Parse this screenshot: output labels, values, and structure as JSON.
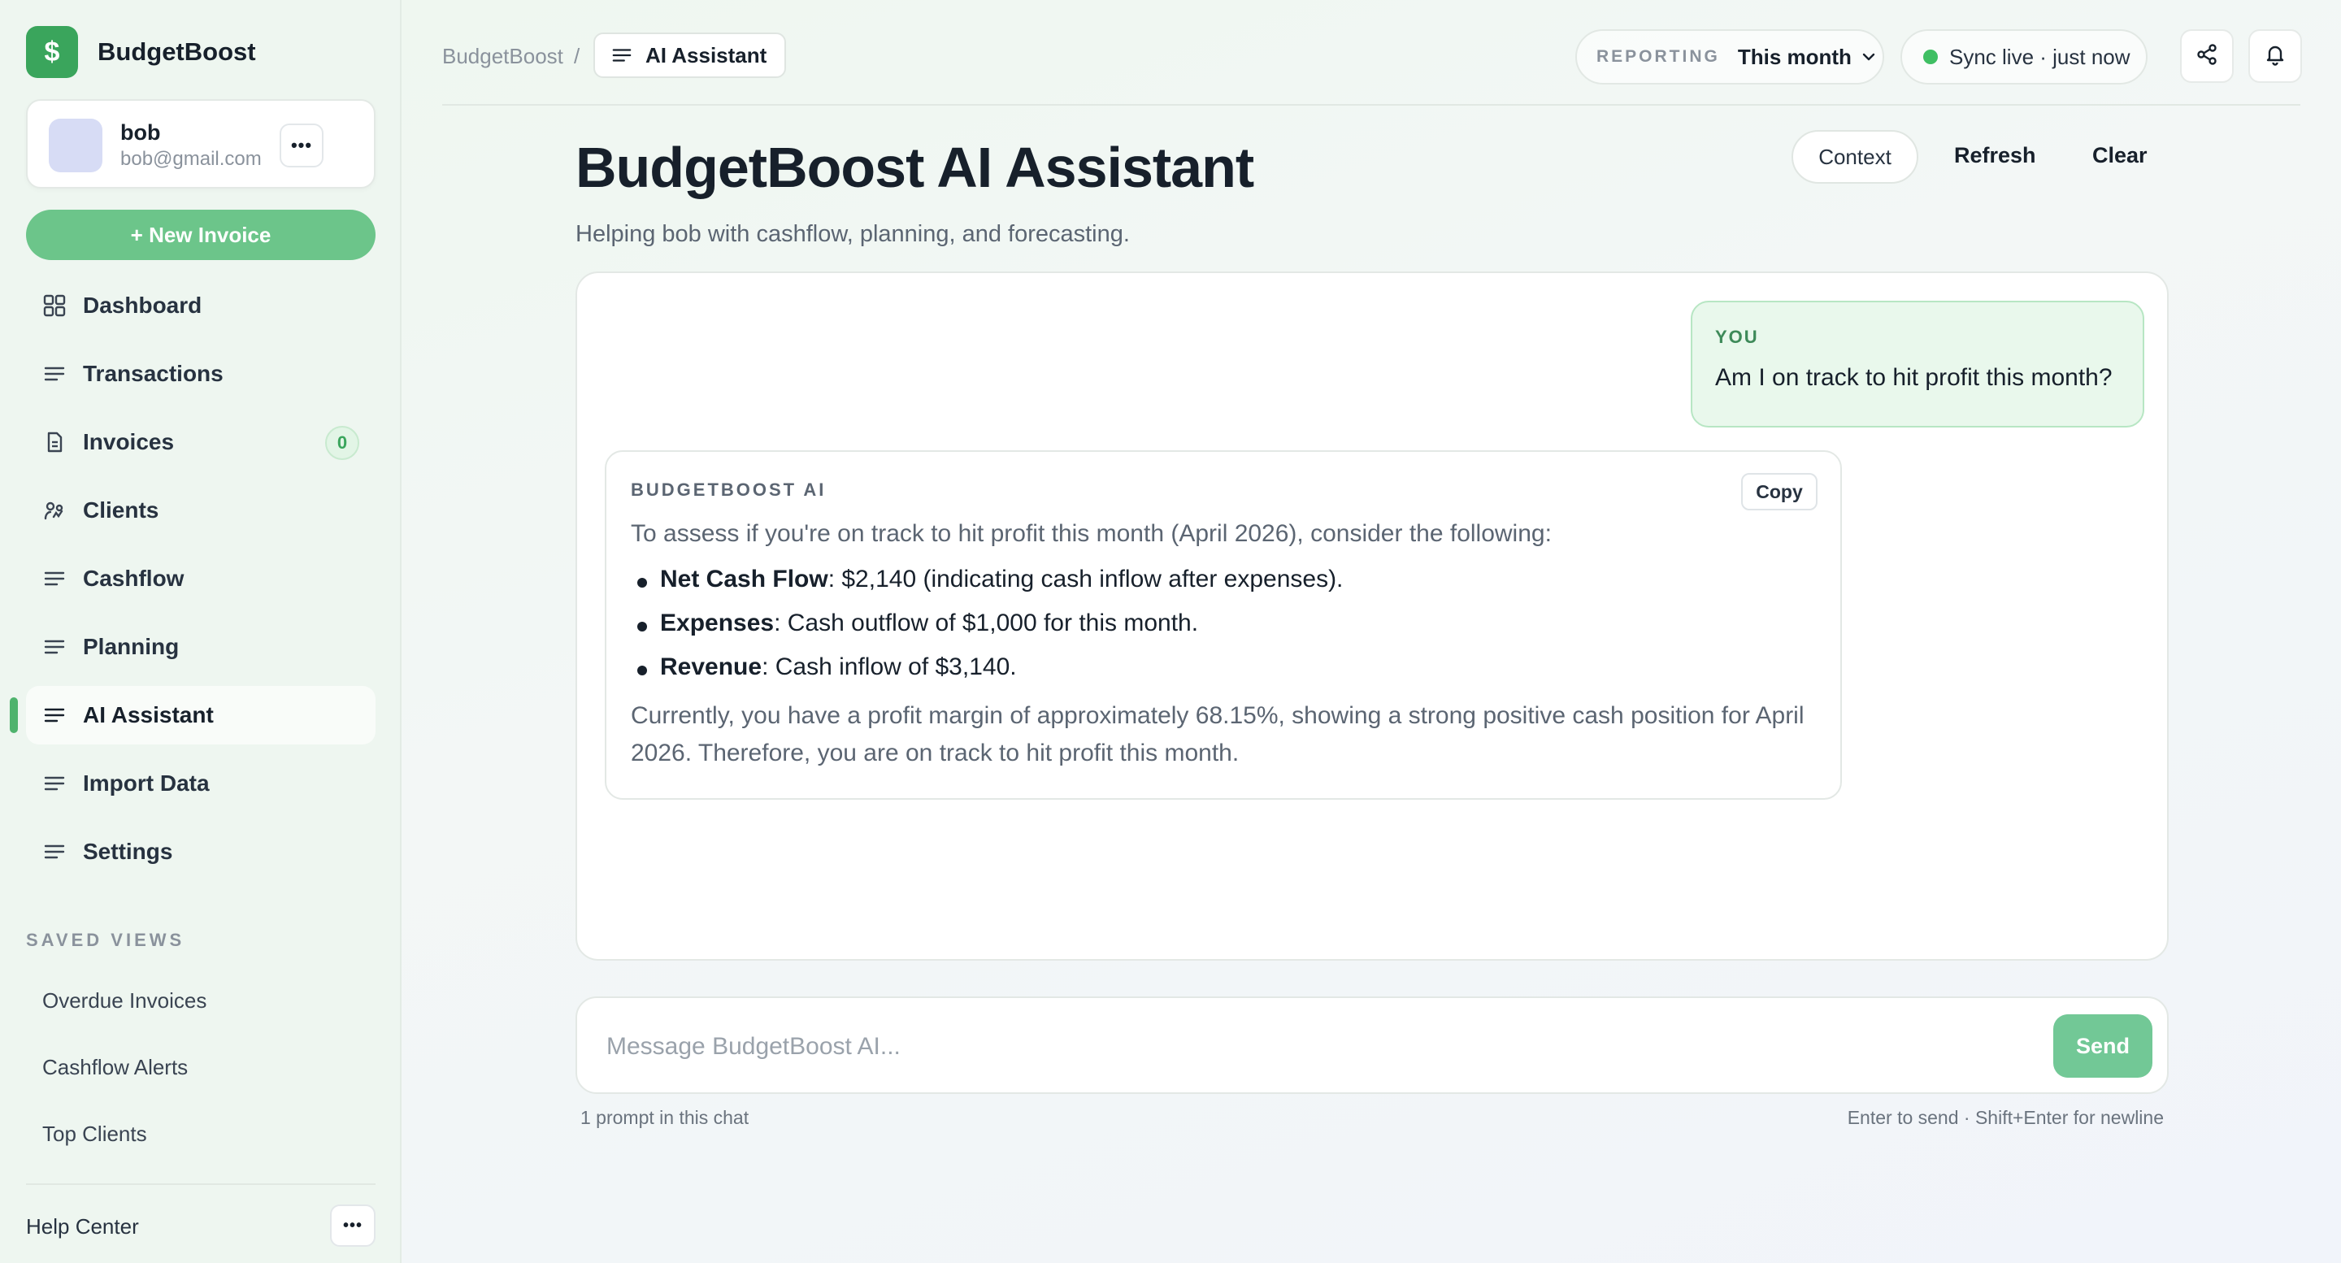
{
  "app": {
    "brand": "BudgetBoost",
    "brand_icon": "dollar-icon",
    "accent": "#3aa55c"
  },
  "user": {
    "name": "bob",
    "email": "bob@gmail.com",
    "more": "•••"
  },
  "sidebar": {
    "new_invoice_label": "+ New Invoice",
    "items": [
      {
        "label": "Dashboard",
        "icon": "grid-icon"
      },
      {
        "label": "Transactions",
        "icon": "lines-icon"
      },
      {
        "label": "Invoices",
        "icon": "document-icon",
        "badge": "0"
      },
      {
        "label": "Clients",
        "icon": "users-icon"
      },
      {
        "label": "Cashflow",
        "icon": "lines-icon"
      },
      {
        "label": "Planning",
        "icon": "lines-icon"
      },
      {
        "label": "AI Assistant",
        "icon": "lines-icon",
        "active": true
      },
      {
        "label": "Import Data",
        "icon": "lines-icon"
      },
      {
        "label": "Settings",
        "icon": "lines-icon"
      }
    ],
    "saved_views_title": "SAVED VIEWS",
    "saved_views": [
      "Overdue Invoices",
      "Cashflow Alerts",
      "Top Clients"
    ],
    "help_label": "Help Center",
    "help_more": "•••"
  },
  "header": {
    "breadcrumb_root": "BudgetBoost",
    "breadcrumb_sep": "/",
    "breadcrumb_current": "AI Assistant",
    "reporting_label": "REPORTING",
    "reporting_value": "This month",
    "sync_text": "Sync live · just now",
    "sync_color": "#3fbf63"
  },
  "main": {
    "title": "BudgetBoost AI Assistant",
    "subtitle": "Helping bob with cashflow, planning, and forecasting.",
    "context_label": "Context",
    "refresh_label": "Refresh",
    "clear_label": "Clear"
  },
  "chat": {
    "user_label": "YOU",
    "user_message": "Am I on track to hit profit this month?",
    "ai_label": "BUDGETBOOST AI",
    "copy_label": "Copy",
    "ai_intro": "To assess if you're on track to hit profit this month (April 2026), consider the following:",
    "ai_points": [
      {
        "term": "Net Cash Flow",
        "text": ": $2,140 (indicating cash inflow after expenses)."
      },
      {
        "term": "Expenses",
        "text": ": Cash outflow of $1,000 for this month."
      },
      {
        "term": "Revenue",
        "text": ": Cash inflow of $3,140."
      }
    ],
    "ai_conclusion": "Currently, you have a profit margin of approximately 68.15%, showing a strong positive cash position for April 2026. Therefore, you are on track to hit profit this month."
  },
  "composer": {
    "placeholder": "Message BudgetBoost AI...",
    "value": "",
    "send_label": "Send",
    "prompt_count": "1 prompt in this chat",
    "hint": "Enter to send · Shift+Enter for newline"
  }
}
